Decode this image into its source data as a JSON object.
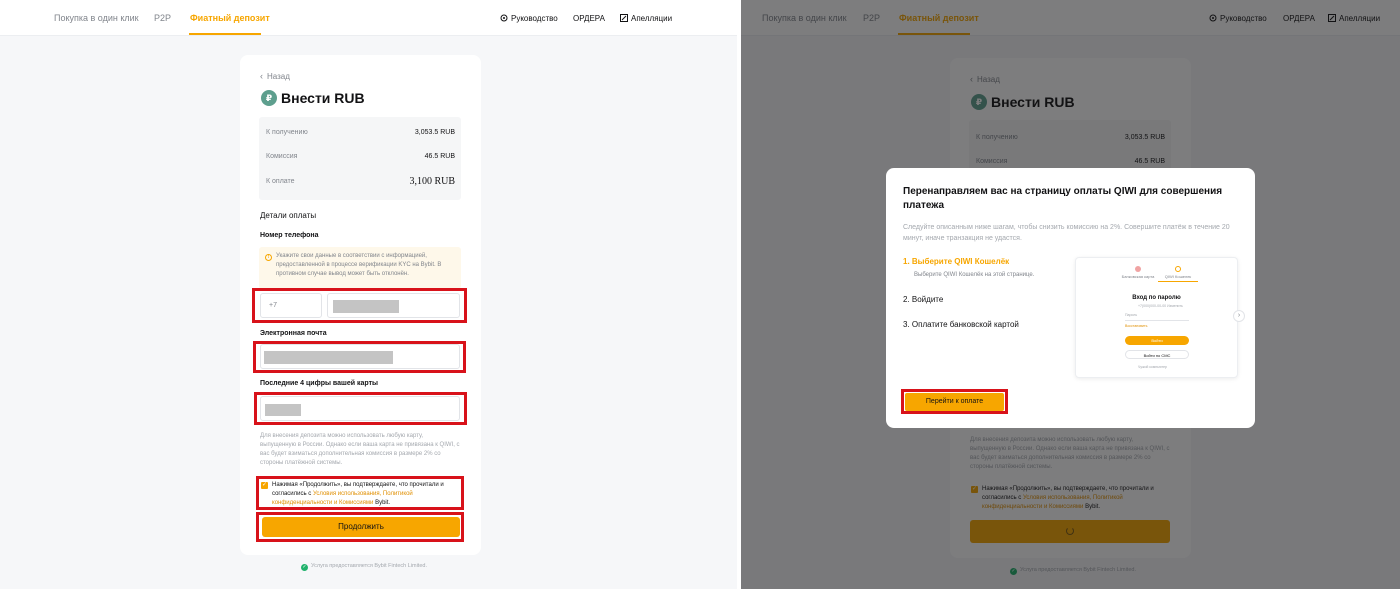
{
  "nav": {
    "tabs": [
      {
        "label": "Покупка в один клик"
      },
      {
        "label": "P2P"
      },
      {
        "label": "Фиатный депозит"
      }
    ],
    "right": [
      {
        "label": "Руководство",
        "icon": "gear-icon"
      },
      {
        "label": "ОРДЕРА",
        "icon": ""
      },
      {
        "label": "Апелляции",
        "icon": "edit-icon"
      }
    ]
  },
  "deposit": {
    "back_label": "Назад",
    "currency_symbol": "₽",
    "title": "Внести RUB",
    "summary": [
      {
        "label": "К получению",
        "value": "3,053.5 RUB"
      },
      {
        "label": "Комиссия",
        "value": "46.5 RUB"
      },
      {
        "label": "К оплате",
        "value": "3,100 RUB"
      }
    ],
    "section_title": "Детали оплаты",
    "phone_label": "Номер телефона",
    "notice": "Укажите свои данные в соответствии с информацией, предоставленной в процессе верификации KYC на Bybit. В противном случае вывод может быть отклонён.",
    "phone_prefix": "+7",
    "email_label": "Электронная почта",
    "card_label": "Последние 4 цифры вашей карты",
    "help": "Для внесения депозита можно использовать любую карту, выпущенную в России. Однако если ваша карта не привязана к QIWI, с вас будет взиматься дополнительная комиссия в размере 2% со стороны платёжной системы.",
    "consent_prefix": "Нажимая «Продолжить», вы подтверждаете, что прочитали и согласились с",
    "consent_terms": "Условия использования",
    "consent_sep1": ",",
    "consent_privacy": "Политикой конфиденциальности",
    "consent_and": "и",
    "consent_fees": "Комиссиями",
    "consent_suffix": "Bybit.",
    "continue_label": "Продолжить",
    "footer": "Услуга предоставляется Bybit Fintech Limited."
  },
  "modal": {
    "title": "Перенаправляем вас на страницу оплаты QIWI для совершения платежа",
    "subtitle": "Следуйте описанным ниже шагам, чтобы снизить комиссию на 2%. Совершите платёж в течение 20 минут, иначе транзакция не удастся.",
    "steps": [
      {
        "label": "1. Выберите QIWI Кошелёк",
        "desc": "Выберите QIWI Кошелёк на этой странице."
      },
      {
        "label": "2. Войдите",
        "desc": ""
      },
      {
        "label": "3. Оплатите банковской картой",
        "desc": ""
      }
    ],
    "cta_label": "Перейти к оплате",
    "preview": {
      "tab_card": "Банковская карта",
      "tab_qiwi": "QIWI Кошелек",
      "login_title": "Вход по паролю",
      "phone_hint": "+7(000)000-00-00 Изменить",
      "password_hint": "Пароль",
      "forgot_hint": "Восстановить",
      "login_btn": "Войти",
      "sms_btn": "Войти по СМС",
      "remember": "Чужой компьютер"
    }
  },
  "colors": {
    "accent": "#f7a600",
    "highlight_frame": "#d8121a"
  }
}
